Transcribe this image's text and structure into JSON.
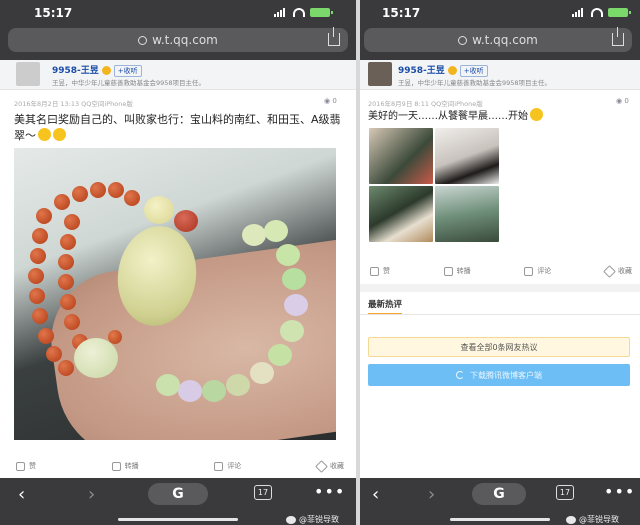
{
  "left": {
    "status_time": "15:17",
    "url": "w.t.qq.com",
    "user": {
      "name": "9958-王昱",
      "follow": "+收听",
      "description": "王昱，中华少年儿童慈善救助基金会9958项目主任。"
    },
    "post": {
      "meta": "2016年8月2日 13:13  QQ空间iPhone版",
      "views": "0",
      "text": "美其名曰奖励自己的、叫败家也行：宝山料的南红、和田玉、A级翡翠～"
    },
    "actions": [
      "赞",
      "转播",
      "评论",
      "收藏"
    ],
    "nav": {
      "tabs_count": "17"
    }
  },
  "right": {
    "status_time": "15:17",
    "url": "w.t.qq.com",
    "user": {
      "name": "9958-王昱",
      "follow": "+收听",
      "description": "王昱，中华少年儿童慈善救助基金会9958项目主任。"
    },
    "post": {
      "meta": "2016年8月9日 8:11  QQ空间iPhone版",
      "views": "0",
      "text": "美好的一天……从饕餮早晨……开始"
    },
    "actions": [
      "赞",
      "转播",
      "评论",
      "收藏"
    ],
    "hot_comments_title": "最新热评",
    "view_all_button": "查看全部0条网友热议",
    "download_button": "下载腾讯微博客户端",
    "nav": {
      "tabs_count": "17"
    }
  },
  "watermark": "@菲锐导致",
  "colors": {
    "chrome_dark": "#3a3a3c",
    "link_blue": "#1a4ea8",
    "download_blue": "#6cbef4",
    "hot_accent": "#f6a623"
  }
}
